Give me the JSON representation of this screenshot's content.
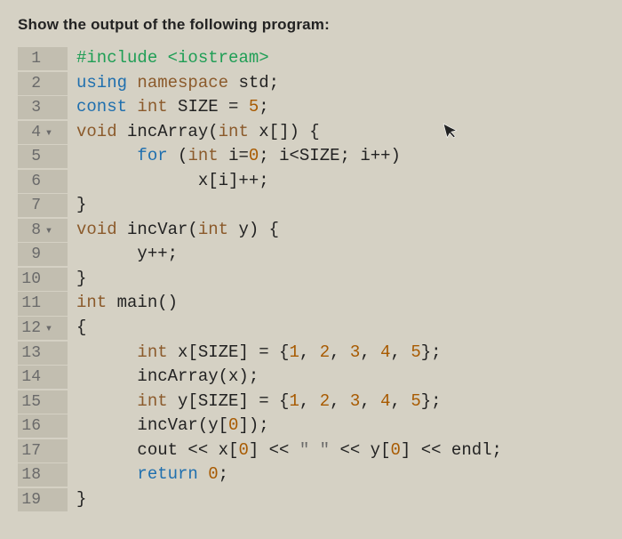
{
  "question": "Show the output of the following program:",
  "code": {
    "lines": [
      {
        "n": "1",
        "fold": "",
        "segments": [
          {
            "cls": "kw-preproc",
            "t": "#include"
          },
          {
            "cls": "ident",
            "t": " "
          },
          {
            "cls": "kw-include-target",
            "t": "<iostream>"
          }
        ]
      },
      {
        "n": "2",
        "fold": "",
        "segments": [
          {
            "cls": "kw-blue",
            "t": "using"
          },
          {
            "cls": "ident",
            "t": " "
          },
          {
            "cls": "kw-brown",
            "t": "namespace"
          },
          {
            "cls": "ident",
            "t": " std;"
          }
        ]
      },
      {
        "n": "3",
        "fold": "",
        "segments": [
          {
            "cls": "kw-blue",
            "t": "const"
          },
          {
            "cls": "ident",
            "t": " "
          },
          {
            "cls": "kw-brown",
            "t": "int"
          },
          {
            "cls": "ident",
            "t": " SIZE = "
          },
          {
            "cls": "num",
            "t": "5"
          },
          {
            "cls": "ident",
            "t": ";"
          }
        ]
      },
      {
        "n": "4",
        "fold": "▾",
        "segments": [
          {
            "cls": "kw-brown",
            "t": "void"
          },
          {
            "cls": "ident",
            "t": " incArray("
          },
          {
            "cls": "kw-brown",
            "t": "int"
          },
          {
            "cls": "ident",
            "t": " x[]) {"
          }
        ]
      },
      {
        "n": "5",
        "fold": "",
        "segments": [
          {
            "cls": "ident",
            "t": "      "
          },
          {
            "cls": "kw-blue",
            "t": "for"
          },
          {
            "cls": "ident",
            "t": " ("
          },
          {
            "cls": "kw-brown",
            "t": "int"
          },
          {
            "cls": "ident",
            "t": " i="
          },
          {
            "cls": "num",
            "t": "0"
          },
          {
            "cls": "ident",
            "t": "; i<SIZE; i++)"
          }
        ]
      },
      {
        "n": "6",
        "fold": "",
        "segments": [
          {
            "cls": "ident",
            "t": "            x[i]++;"
          }
        ]
      },
      {
        "n": "7",
        "fold": "",
        "segments": [
          {
            "cls": "ident",
            "t": "}"
          }
        ]
      },
      {
        "n": "8",
        "fold": "▾",
        "segments": [
          {
            "cls": "kw-brown",
            "t": "void"
          },
          {
            "cls": "ident",
            "t": " incVar("
          },
          {
            "cls": "kw-brown",
            "t": "int"
          },
          {
            "cls": "ident",
            "t": " y) {"
          }
        ]
      },
      {
        "n": "9",
        "fold": "",
        "segments": [
          {
            "cls": "ident",
            "t": "      y++;"
          }
        ]
      },
      {
        "n": "10",
        "fold": "",
        "segments": [
          {
            "cls": "ident",
            "t": "}"
          }
        ]
      },
      {
        "n": "11",
        "fold": "",
        "segments": [
          {
            "cls": "kw-brown",
            "t": "int"
          },
          {
            "cls": "ident",
            "t": " main()"
          }
        ]
      },
      {
        "n": "12",
        "fold": "▾",
        "segments": [
          {
            "cls": "ident",
            "t": "{"
          }
        ]
      },
      {
        "n": "13",
        "fold": "",
        "segments": [
          {
            "cls": "ident",
            "t": "      "
          },
          {
            "cls": "kw-brown",
            "t": "int"
          },
          {
            "cls": "ident",
            "t": " x[SIZE] = {"
          },
          {
            "cls": "num",
            "t": "1"
          },
          {
            "cls": "ident",
            "t": ", "
          },
          {
            "cls": "num",
            "t": "2"
          },
          {
            "cls": "ident",
            "t": ", "
          },
          {
            "cls": "num",
            "t": "3"
          },
          {
            "cls": "ident",
            "t": ", "
          },
          {
            "cls": "num",
            "t": "4"
          },
          {
            "cls": "ident",
            "t": ", "
          },
          {
            "cls": "num",
            "t": "5"
          },
          {
            "cls": "ident",
            "t": "};"
          }
        ]
      },
      {
        "n": "14",
        "fold": "",
        "segments": [
          {
            "cls": "ident",
            "t": "      incArray(x);"
          }
        ]
      },
      {
        "n": "15",
        "fold": "",
        "segments": [
          {
            "cls": "ident",
            "t": "      "
          },
          {
            "cls": "kw-brown",
            "t": "int"
          },
          {
            "cls": "ident",
            "t": " y[SIZE] = {"
          },
          {
            "cls": "num",
            "t": "1"
          },
          {
            "cls": "ident",
            "t": ", "
          },
          {
            "cls": "num",
            "t": "2"
          },
          {
            "cls": "ident",
            "t": ", "
          },
          {
            "cls": "num",
            "t": "3"
          },
          {
            "cls": "ident",
            "t": ", "
          },
          {
            "cls": "num",
            "t": "4"
          },
          {
            "cls": "ident",
            "t": ", "
          },
          {
            "cls": "num",
            "t": "5"
          },
          {
            "cls": "ident",
            "t": "};"
          }
        ]
      },
      {
        "n": "16",
        "fold": "",
        "segments": [
          {
            "cls": "ident",
            "t": "      incVar(y["
          },
          {
            "cls": "num",
            "t": "0"
          },
          {
            "cls": "ident",
            "t": "]);"
          }
        ]
      },
      {
        "n": "17",
        "fold": "",
        "segments": [
          {
            "cls": "ident",
            "t": "      cout << x["
          },
          {
            "cls": "num",
            "t": "0"
          },
          {
            "cls": "ident",
            "t": "] << "
          },
          {
            "cls": "str",
            "t": "\" \""
          },
          {
            "cls": "ident",
            "t": " << y["
          },
          {
            "cls": "num",
            "t": "0"
          },
          {
            "cls": "ident",
            "t": "] << endl;"
          }
        ]
      },
      {
        "n": "18",
        "fold": "",
        "segments": [
          {
            "cls": "ident",
            "t": "      "
          },
          {
            "cls": "kw-blue",
            "t": "return"
          },
          {
            "cls": "ident",
            "t": " "
          },
          {
            "cls": "num",
            "t": "0"
          },
          {
            "cls": "ident",
            "t": ";"
          }
        ]
      },
      {
        "n": "19",
        "fold": "",
        "segments": [
          {
            "cls": "ident",
            "t": "}"
          }
        ]
      }
    ]
  },
  "cursor_glyph": "➤"
}
